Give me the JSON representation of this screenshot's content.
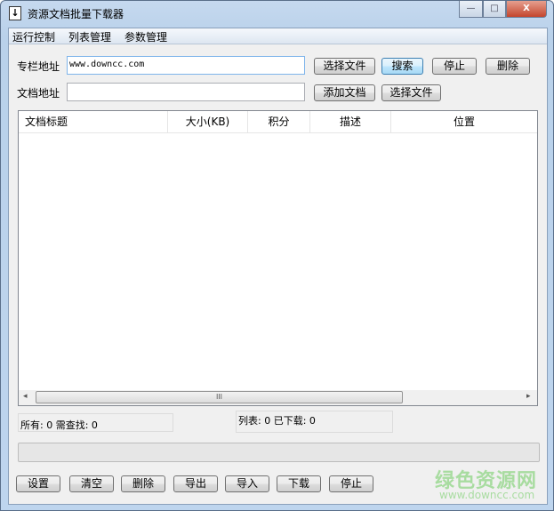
{
  "window": {
    "title": "资源文档批量下载器",
    "minimize": "—",
    "maximize": "□",
    "close": "X"
  },
  "menu": [
    "运行控制",
    "列表管理",
    "参数管理"
  ],
  "row1": {
    "label": "专栏地址",
    "value": "www.downcc.com",
    "btn_select": "选择文件",
    "btn_search": "搜索",
    "btn_stop": "停止",
    "btn_delete": "删除"
  },
  "row2": {
    "label": "文档地址",
    "value": "",
    "btn_add": "添加文档",
    "btn_select": "选择文件"
  },
  "table": {
    "columns": [
      "文档标题",
      "大小(KB)",
      "积分",
      "描述",
      "位置"
    ],
    "rows": [],
    "scroll_grip": "III",
    "left_arrow": "◂",
    "right_arrow": "▸"
  },
  "status": {
    "left": "所有: 0 需查找: 0",
    "right": "列表: 0 已下载: 0"
  },
  "progress": 0,
  "buttons": [
    "设置",
    "清空",
    "删除",
    "导出",
    "导入",
    "下载",
    "停止"
  ],
  "watermark": {
    "name": "绿色资源网",
    "url": "www.downcc.com"
  }
}
